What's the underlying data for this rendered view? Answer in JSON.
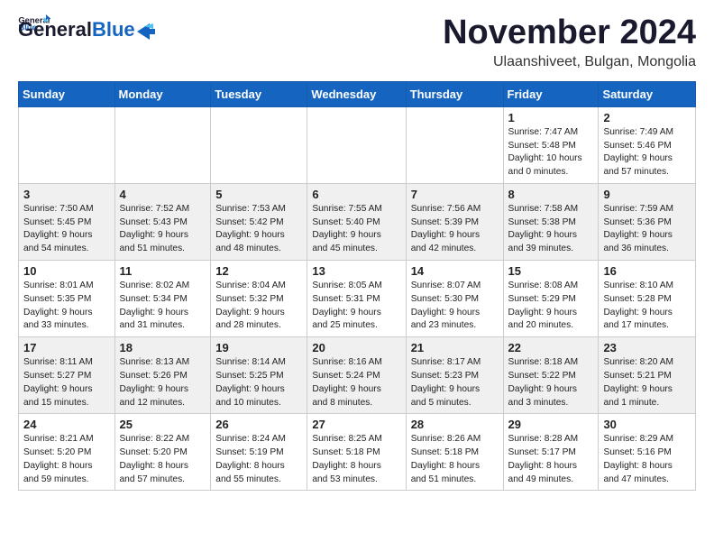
{
  "logo": {
    "line1": "General",
    "line2": "Blue"
  },
  "header": {
    "month": "November 2024",
    "location": "Ulaanshiveet, Bulgan, Mongolia"
  },
  "weekdays": [
    "Sunday",
    "Monday",
    "Tuesday",
    "Wednesday",
    "Thursday",
    "Friday",
    "Saturday"
  ],
  "weeks": [
    [
      {
        "day": "",
        "info": ""
      },
      {
        "day": "",
        "info": ""
      },
      {
        "day": "",
        "info": ""
      },
      {
        "day": "",
        "info": ""
      },
      {
        "day": "",
        "info": ""
      },
      {
        "day": "1",
        "info": "Sunrise: 7:47 AM\nSunset: 5:48 PM\nDaylight: 10 hours\nand 0 minutes."
      },
      {
        "day": "2",
        "info": "Sunrise: 7:49 AM\nSunset: 5:46 PM\nDaylight: 9 hours\nand 57 minutes."
      }
    ],
    [
      {
        "day": "3",
        "info": "Sunrise: 7:50 AM\nSunset: 5:45 PM\nDaylight: 9 hours\nand 54 minutes."
      },
      {
        "day": "4",
        "info": "Sunrise: 7:52 AM\nSunset: 5:43 PM\nDaylight: 9 hours\nand 51 minutes."
      },
      {
        "day": "5",
        "info": "Sunrise: 7:53 AM\nSunset: 5:42 PM\nDaylight: 9 hours\nand 48 minutes."
      },
      {
        "day": "6",
        "info": "Sunrise: 7:55 AM\nSunset: 5:40 PM\nDaylight: 9 hours\nand 45 minutes."
      },
      {
        "day": "7",
        "info": "Sunrise: 7:56 AM\nSunset: 5:39 PM\nDaylight: 9 hours\nand 42 minutes."
      },
      {
        "day": "8",
        "info": "Sunrise: 7:58 AM\nSunset: 5:38 PM\nDaylight: 9 hours\nand 39 minutes."
      },
      {
        "day": "9",
        "info": "Sunrise: 7:59 AM\nSunset: 5:36 PM\nDaylight: 9 hours\nand 36 minutes."
      }
    ],
    [
      {
        "day": "10",
        "info": "Sunrise: 8:01 AM\nSunset: 5:35 PM\nDaylight: 9 hours\nand 33 minutes."
      },
      {
        "day": "11",
        "info": "Sunrise: 8:02 AM\nSunset: 5:34 PM\nDaylight: 9 hours\nand 31 minutes."
      },
      {
        "day": "12",
        "info": "Sunrise: 8:04 AM\nSunset: 5:32 PM\nDaylight: 9 hours\nand 28 minutes."
      },
      {
        "day": "13",
        "info": "Sunrise: 8:05 AM\nSunset: 5:31 PM\nDaylight: 9 hours\nand 25 minutes."
      },
      {
        "day": "14",
        "info": "Sunrise: 8:07 AM\nSunset: 5:30 PM\nDaylight: 9 hours\nand 23 minutes."
      },
      {
        "day": "15",
        "info": "Sunrise: 8:08 AM\nSunset: 5:29 PM\nDaylight: 9 hours\nand 20 minutes."
      },
      {
        "day": "16",
        "info": "Sunrise: 8:10 AM\nSunset: 5:28 PM\nDaylight: 9 hours\nand 17 minutes."
      }
    ],
    [
      {
        "day": "17",
        "info": "Sunrise: 8:11 AM\nSunset: 5:27 PM\nDaylight: 9 hours\nand 15 minutes."
      },
      {
        "day": "18",
        "info": "Sunrise: 8:13 AM\nSunset: 5:26 PM\nDaylight: 9 hours\nand 12 minutes."
      },
      {
        "day": "19",
        "info": "Sunrise: 8:14 AM\nSunset: 5:25 PM\nDaylight: 9 hours\nand 10 minutes."
      },
      {
        "day": "20",
        "info": "Sunrise: 8:16 AM\nSunset: 5:24 PM\nDaylight: 9 hours\nand 8 minutes."
      },
      {
        "day": "21",
        "info": "Sunrise: 8:17 AM\nSunset: 5:23 PM\nDaylight: 9 hours\nand 5 minutes."
      },
      {
        "day": "22",
        "info": "Sunrise: 8:18 AM\nSunset: 5:22 PM\nDaylight: 9 hours\nand 3 minutes."
      },
      {
        "day": "23",
        "info": "Sunrise: 8:20 AM\nSunset: 5:21 PM\nDaylight: 9 hours\nand 1 minute."
      }
    ],
    [
      {
        "day": "24",
        "info": "Sunrise: 8:21 AM\nSunset: 5:20 PM\nDaylight: 8 hours\nand 59 minutes."
      },
      {
        "day": "25",
        "info": "Sunrise: 8:22 AM\nSunset: 5:20 PM\nDaylight: 8 hours\nand 57 minutes."
      },
      {
        "day": "26",
        "info": "Sunrise: 8:24 AM\nSunset: 5:19 PM\nDaylight: 8 hours\nand 55 minutes."
      },
      {
        "day": "27",
        "info": "Sunrise: 8:25 AM\nSunset: 5:18 PM\nDaylight: 8 hours\nand 53 minutes."
      },
      {
        "day": "28",
        "info": "Sunrise: 8:26 AM\nSunset: 5:18 PM\nDaylight: 8 hours\nand 51 minutes."
      },
      {
        "day": "29",
        "info": "Sunrise: 8:28 AM\nSunset: 5:17 PM\nDaylight: 8 hours\nand 49 minutes."
      },
      {
        "day": "30",
        "info": "Sunrise: 8:29 AM\nSunset: 5:16 PM\nDaylight: 8 hours\nand 47 minutes."
      }
    ]
  ]
}
